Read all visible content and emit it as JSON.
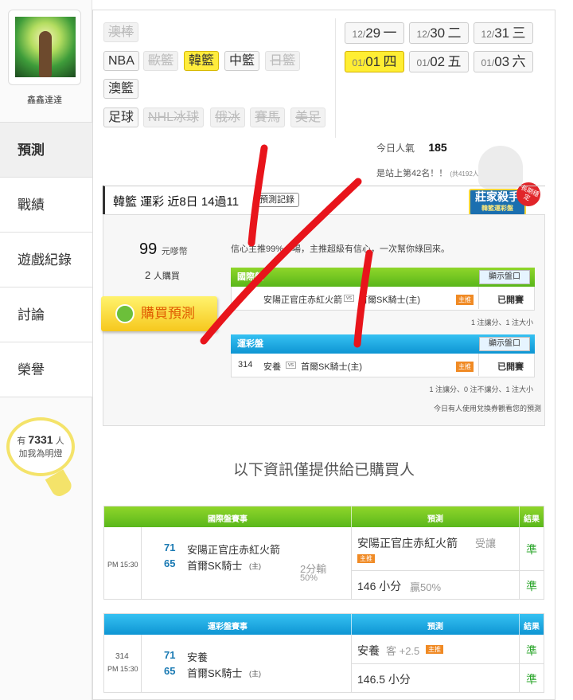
{
  "sidebar": {
    "username": "鑫鑫達達",
    "items": [
      "預測",
      "戰績",
      "遊戲紀錄",
      "討論",
      "榮譽"
    ],
    "fans": {
      "prefix": "有",
      "count": "7331",
      "suffix": "人",
      "caption": "加我為明燈"
    }
  },
  "leagues": {
    "row1": [
      "澳棒"
    ],
    "row2": [
      "NBA",
      "歐籃",
      "韓籃",
      "中籃",
      "日籃"
    ],
    "row3": [
      "澳籃"
    ],
    "row4": [
      "足球",
      "NHL冰球",
      "俄冰",
      "賽馬",
      "美足"
    ],
    "selected": "韓籃"
  },
  "dates": [
    {
      "md": "12/",
      "day": "29",
      "wd": "一"
    },
    {
      "md": "12/",
      "day": "30",
      "wd": "二"
    },
    {
      "md": "12/",
      "day": "31",
      "wd": "三"
    },
    {
      "md": "01/",
      "day": "01",
      "wd": "四",
      "selected": true
    },
    {
      "md": "01/",
      "day": "02",
      "wd": "五"
    },
    {
      "md": "01/",
      "day": "03",
      "wd": "六"
    }
  ],
  "popularity": {
    "label": "今日人氣",
    "value": "185",
    "rank_text": "是站上第42名！！",
    "rank_total": "(共4192人)"
  },
  "badge": {
    "title": "莊家殺手",
    "subtitle": "韓籃運彩盤",
    "corner": "長期穩定"
  },
  "headline": {
    "text": "韓籃 運彩 近8日 14過11",
    "history_button": "預測記錄"
  },
  "purchase": {
    "price": "99",
    "price_unit": "元嗲幣",
    "buyers": "2",
    "buyers_unit": "人購買",
    "buy_button": "購買預測",
    "confidence": "信心主推99%一場，主推超級有信心，一次幫你綠回來。"
  },
  "preview": {
    "intl": {
      "title": "國際盤",
      "show_button": "顯示盤口",
      "away": "安陽正官庄赤紅火箭",
      "home": "首爾SK騎士(主)",
      "pick": "主推",
      "status": "已開賽",
      "note": "1 注讓分、1 注大小"
    },
    "sport_lottery": {
      "title": "運彩盤",
      "show_button": "顯示盤口",
      "number": "314",
      "away": "安養",
      "home": "首爾SK騎士(主)",
      "pick": "主推",
      "status": "已開賽",
      "note": "1 注讓分、0 注不讓分、1 注大小",
      "footer": "今日有人使用兌換券觀看您的預測"
    },
    "vs": "vs"
  },
  "info_text": "以下資訊僅提供給已購買人",
  "results": {
    "intl": {
      "header": {
        "event": "國際盤賽事",
        "prediction": "預測",
        "result": "結果"
      },
      "time": "PM 15:30",
      "away_score": "71",
      "away": "安陽正官庄赤紅火箭",
      "home_score": "65",
      "home": "首爾SK騎士",
      "home_tag": "(主)",
      "margin": "2分輸",
      "margin_pct": "50%",
      "pred1_team": "安陽正官庄赤紅火箭",
      "pred1_tag": "受讓",
      "pred1_pick": "主推",
      "pred1_result": "準",
      "pred2": "146 小分",
      "pred2_extra": "贏50%",
      "pred2_result": "準"
    },
    "sport_lottery": {
      "header": {
        "event": "運彩盤賽事",
        "prediction": "預測",
        "result": "結果"
      },
      "number": "314",
      "time": "PM 15:30",
      "away_score": "71",
      "away": "安養",
      "home_score": "65",
      "home": "首爾SK騎士",
      "home_tag": "(主)",
      "pred1_team": "安養",
      "pred1_tag": "客 +2.5",
      "pred1_pick": "主推",
      "pred1_result": "準",
      "pred2": "146.5 小分",
      "pred2_result": "準"
    }
  },
  "colors": {
    "selected_yellow": "#ffec3d",
    "green_header": "#6cc11f",
    "blue_header": "#1aa6e0",
    "annotation_red": "#e8141b"
  }
}
